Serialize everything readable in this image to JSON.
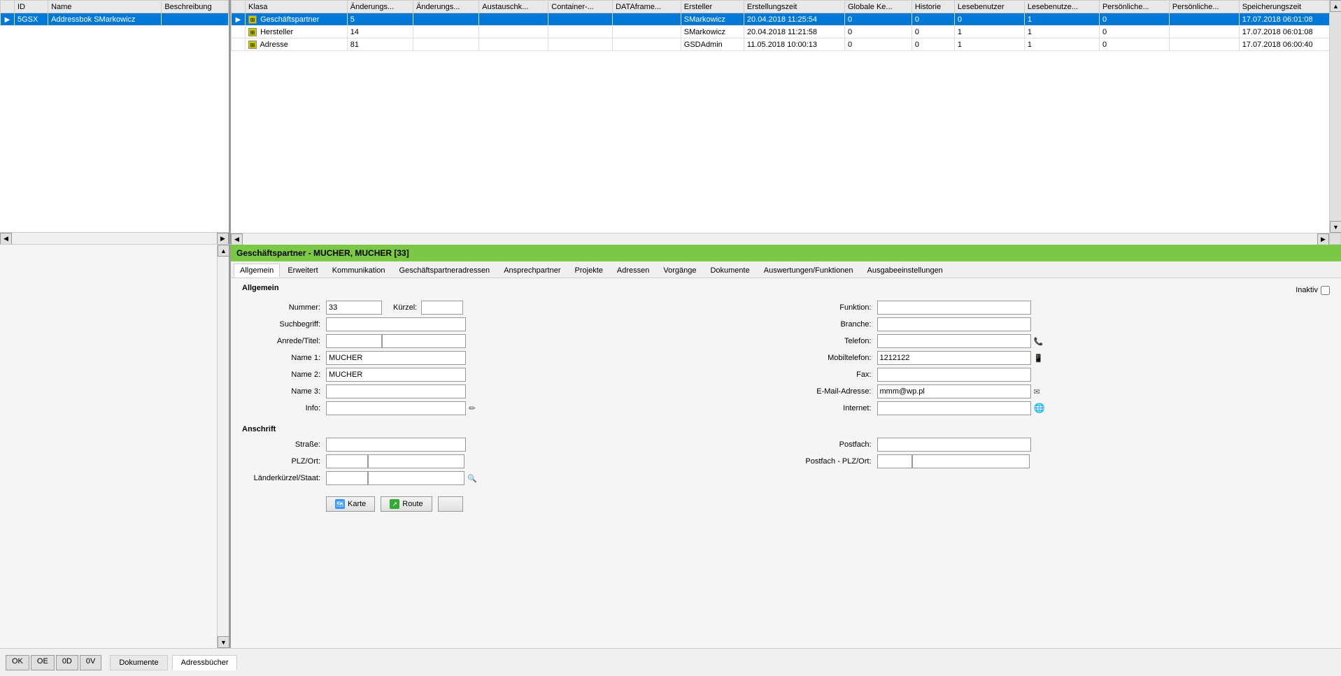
{
  "header": {
    "title": "Geschäftspartner  -  MUCHER, MUCHER [33]"
  },
  "top_table_left": {
    "columns": [
      "ID",
      "Name",
      "Beschreibung"
    ],
    "rows": [
      {
        "id": "5GSX",
        "name": "Addressbok SMarkowicz",
        "beschreibung": ""
      }
    ]
  },
  "top_table_right": {
    "columns": [
      "Klasa",
      "Änderungs...",
      "Änderungs...",
      "Austauschk...",
      "Container-...",
      "DATAframe...",
      "Ersteller",
      "Erstellungszeit",
      "Globale Ke...",
      "Historie",
      "Lesebenutzer",
      "Lesebenutze...",
      "Persönliche...",
      "Persönliche...",
      "Speicherungszeit"
    ],
    "rows": [
      {
        "klasa": "Geschäftspartner",
        "aend1": "5",
        "aend2": "",
        "austausch": "",
        "container": "",
        "dataframe": "",
        "ersteller": "SMarkowicz",
        "erstellung": "20.04.2018 11:25:54",
        "globale": "0",
        "historie": "0",
        "lesebenutzer": "0",
        "lesebenutze": "1",
        "persoenl1": "0",
        "persoenl2": "",
        "speicher": "17.07.2018 06:01:08"
      },
      {
        "klasa": "Hersteller",
        "aend1": "14",
        "aend2": "",
        "austausch": "",
        "container": "",
        "dataframe": "",
        "ersteller": "SMarkowicz",
        "erstellung": "20.04.2018 11:21:58",
        "globale": "0",
        "historie": "0",
        "lesebenutzer": "1",
        "lesebenutze": "1",
        "persoenl1": "0",
        "persoenl2": "",
        "speicher": "17.07.2018 06:01:08"
      },
      {
        "klasa": "Adresse",
        "aend1": "81",
        "aend2": "",
        "austausch": "",
        "container": "",
        "dataframe": "",
        "ersteller": "GSDAdmin",
        "erstellung": "11.05.2018 10:00:13",
        "globale": "0",
        "historie": "0",
        "lesebenutzer": "1",
        "lesebenutze": "1",
        "persoenl1": "0",
        "persoenl2": "",
        "speicher": "17.07.2018 06:00:40"
      }
    ]
  },
  "tabs": {
    "items": [
      "Allgemein",
      "Erweitert",
      "Kommunikation",
      "Geschäftspartneradressen",
      "Ansprechpartner",
      "Projekte",
      "Adressen",
      "Vorgänge",
      "Dokumente",
      "Auswertungen/Funktionen",
      "Ausgabeeinstellungen"
    ],
    "active": "Allgemein"
  },
  "form": {
    "sections": {
      "allgemein": "Allgemein",
      "anschrift": "Anschrift"
    },
    "inaktiv_label": "Inaktiv",
    "fields": {
      "nummer_label": "Nummer:",
      "nummer_value": "33",
      "kuerzel_label": "Kürzel:",
      "kuerzel_value": "",
      "funktion_label": "Funktion:",
      "funktion_value": "",
      "suchbegriff_label": "Suchbegriff:",
      "suchbegriff_value": "",
      "branche_label": "Branche:",
      "branche_value": "",
      "anrede_label": "Anrede/Titel:",
      "anrede_value": "",
      "titel_value": "",
      "telefon_label": "Telefon:",
      "telefon_value": "",
      "name1_label": "Name 1:",
      "name1_value": "MUCHER",
      "mobiltelefon_label": "Mobiltelefon:",
      "mobiltelefon_value": "1212122",
      "name2_label": "Name 2:",
      "name2_value": "MUCHER",
      "fax_label": "Fax:",
      "fax_value": "",
      "name3_label": "Name 3:",
      "name3_value": "",
      "email_label": "E-Mail-Adresse:",
      "email_value": "mmm@wp.pl",
      "info_label": "Info:",
      "info_value": "",
      "internet_label": "Internet:",
      "internet_value": "",
      "strasse_label": "Straße:",
      "strasse_value": "",
      "postfach_label": "Postfach:",
      "postfach_value": "",
      "plz_label": "PLZ/Ort:",
      "plz_value": "",
      "ort_value": "",
      "postfach_plz_label": "Postfach - PLZ/Ort:",
      "postfach_plz_value": "",
      "postfach_ort_value": "",
      "laenderkuerzel_label": "Länderkürzel/Staat:",
      "laenderkuerzel_value": "",
      "staat_value": ""
    },
    "buttons": {
      "karte": "Karte",
      "route": "Route",
      "third": ""
    }
  },
  "bottom": {
    "tabs": [
      "Dokumente",
      "Adressbücher"
    ],
    "active_tab": "Adressbücher",
    "footer_buttons": [
      "OK",
      "OE",
      "0D",
      "0V"
    ]
  }
}
